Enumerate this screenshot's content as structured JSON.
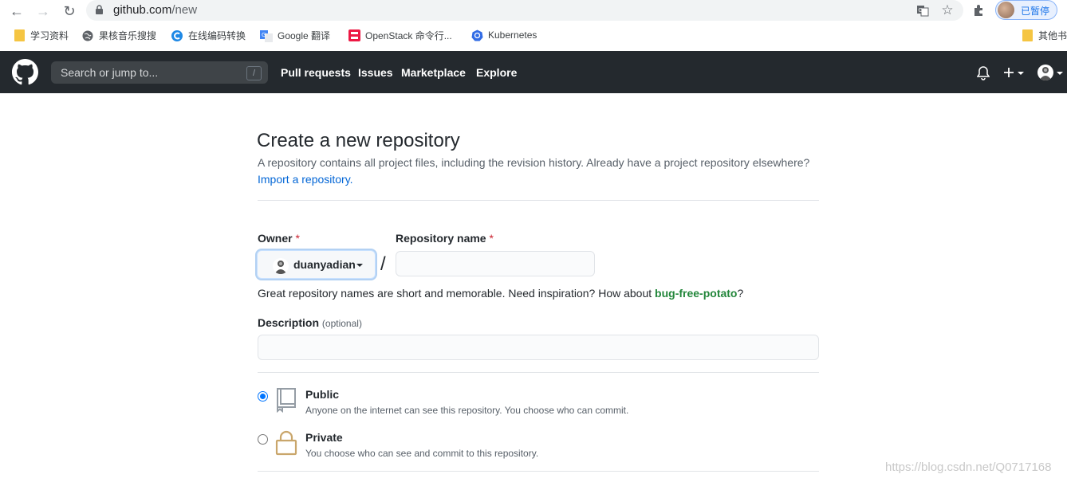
{
  "browser": {
    "url_host": "github.com",
    "url_path": "/new",
    "profile_label": "已暂停",
    "bookmarks": [
      {
        "label": "学习资料",
        "icon": "folder-icon"
      },
      {
        "label": "果核音乐搜搜",
        "icon": "globe-icon"
      },
      {
        "label": "在线编码转换",
        "icon": "c-logo-icon"
      },
      {
        "label": "Google 翻译",
        "icon": "google-translate-icon"
      },
      {
        "label": "OpenStack 命令行...",
        "icon": "openstack-icon"
      },
      {
        "label": "Kubernetes",
        "icon": "kubernetes-icon"
      }
    ],
    "other_bookmarks": "其他书"
  },
  "header": {
    "search_placeholder": "Search or jump to...",
    "search_shortcut": "/",
    "nav": [
      "Pull requests",
      "Issues",
      "Marketplace",
      "Explore"
    ]
  },
  "form": {
    "title": "Create a new repository",
    "subtitle": "A repository contains all project files, including the revision history. Already have a project repository elsewhere?",
    "import_link": "Import a repository.",
    "owner_label": "Owner",
    "required_mark": "*",
    "owner_value": "duanyadian",
    "separator": "/",
    "repo_label": "Repository name",
    "repo_value": "",
    "hint_prefix": "Great repository names are short and memorable. Need inspiration? How about ",
    "hint_suggestion": "bug-free-potato",
    "hint_suffix": "?",
    "description_label": "Description",
    "description_optional": "(optional)",
    "description_value": "",
    "visibility": [
      {
        "title": "Public",
        "desc": "Anyone on the internet can see this repository. You choose who can commit.",
        "selected": true
      },
      {
        "title": "Private",
        "desc": "You choose who can see and commit to this repository.",
        "selected": false
      }
    ]
  },
  "watermark": "https://blog.csdn.net/Q0717168",
  "colors": {
    "header_bg": "#24292e",
    "link": "#0366d6",
    "suggestion": "#22863a",
    "required": "#cb2431"
  }
}
